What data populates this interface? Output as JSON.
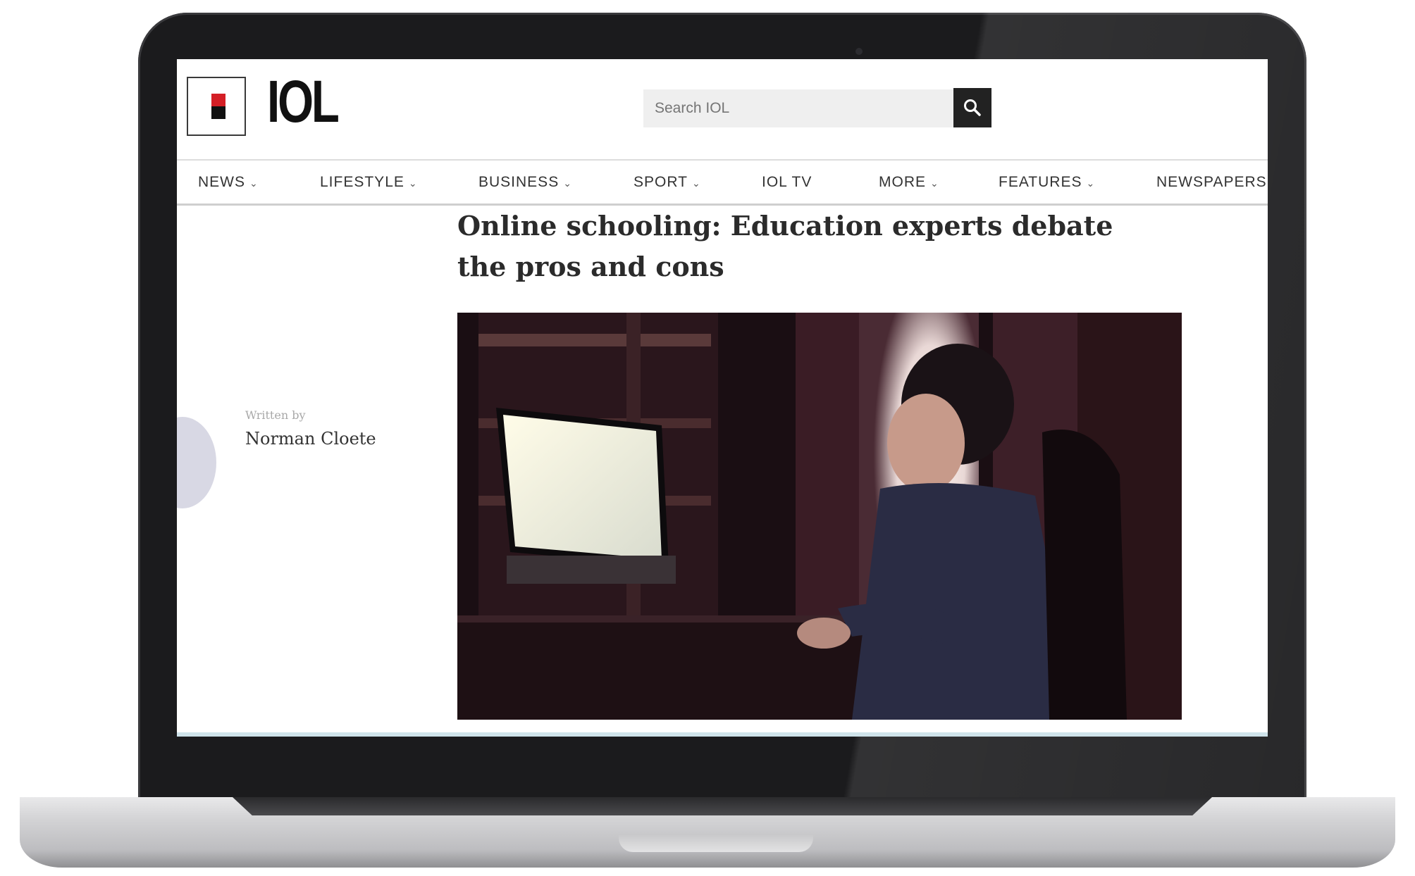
{
  "site": {
    "logo_text": "IOL"
  },
  "search": {
    "placeholder": "Search IOL"
  },
  "nav": {
    "items": [
      {
        "label": "NEWS",
        "has_menu": true
      },
      {
        "label": "LIFESTYLE",
        "has_menu": true
      },
      {
        "label": "BUSINESS",
        "has_menu": true
      },
      {
        "label": "SPORT",
        "has_menu": true
      },
      {
        "label": "IOL TV",
        "has_menu": false
      },
      {
        "label": "MORE",
        "has_menu": true
      },
      {
        "label": "FEATURES",
        "has_menu": true
      },
      {
        "label": "NEWSPAPERS",
        "has_menu": false
      }
    ],
    "chevron": "⌄"
  },
  "article": {
    "title": "Online schooling: Education experts debate the pros and cons",
    "byline_label": "Written by",
    "author": "Norman Cloete"
  },
  "colors": {
    "brand_red": "#d41f26",
    "brand_black": "#111111",
    "search_button": "#222222"
  },
  "icons": {
    "search": "magnifier-icon",
    "avatar": "author-avatar"
  }
}
